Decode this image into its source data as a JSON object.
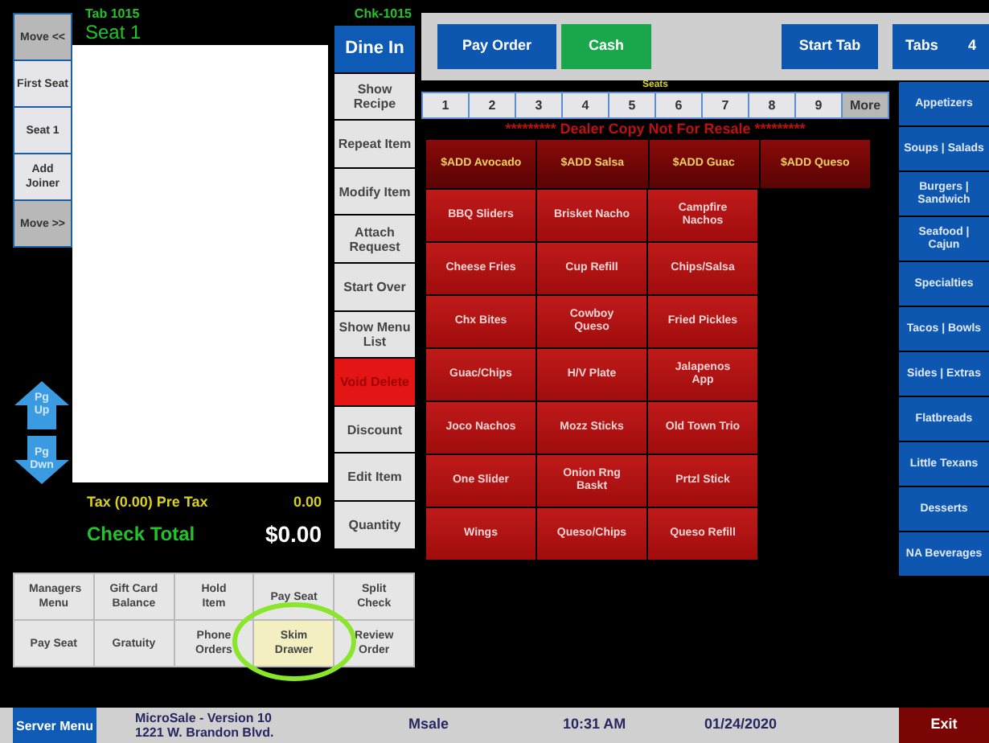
{
  "left_buttons": [
    {
      "label": "Move <<",
      "kind": "nav"
    },
    {
      "label": "First Seat",
      "kind": "seat"
    },
    {
      "label": "Seat 1",
      "kind": "seat"
    },
    {
      "label": "Add Joiner",
      "kind": "seat"
    },
    {
      "label": "Move >>",
      "kind": "nav"
    }
  ],
  "page_buttons": [
    {
      "label": "Pg Up",
      "kind": "up"
    },
    {
      "label": "Pg Dwn",
      "kind": "down"
    }
  ],
  "check": {
    "tab": "Tab  1015",
    "number": "Chk-1015",
    "seat": "Seat 1",
    "tax_label": "Tax (0.00)  Pre Tax",
    "tax_value": "0.00",
    "total_label": "Check Total",
    "total_value": "$0.00"
  },
  "function_buttons": [
    {
      "label": "Dine In",
      "kind": "blue"
    },
    {
      "label": "Show Recipe",
      "kind": "gray"
    },
    {
      "label": "Repeat Item",
      "kind": "gray"
    },
    {
      "label": "Modify Item",
      "kind": "gray"
    },
    {
      "label": "Attach Request",
      "kind": "gray"
    },
    {
      "label": "Start Over",
      "kind": "gray"
    },
    {
      "label": "Show Menu List",
      "kind": "gray"
    },
    {
      "label": "Void Delete",
      "kind": "red"
    },
    {
      "label": "Discount",
      "kind": "gray"
    },
    {
      "label": "Edit Item",
      "kind": "gray"
    },
    {
      "label": "Quantity",
      "kind": "gray"
    }
  ],
  "bottom_buttons": [
    {
      "label": "Managers Menu",
      "highlighted": false
    },
    {
      "label": "Gift Card Balance",
      "highlighted": false
    },
    {
      "label": "Hold Item",
      "highlighted": false
    },
    {
      "label": "Pay Seat",
      "highlighted": false
    },
    {
      "label": "Split Check",
      "highlighted": false
    },
    {
      "label": "Pay Seat",
      "highlighted": false
    },
    {
      "label": "Gratuity",
      "highlighted": false
    },
    {
      "label": "Phone Orders",
      "highlighted": false
    },
    {
      "label": "Skim Drawer",
      "highlighted": true
    },
    {
      "label": "Review Order",
      "highlighted": false
    }
  ],
  "top_buttons": [
    {
      "label": "Pay Order",
      "kind": "blue"
    },
    {
      "label": "Cash",
      "kind": "green"
    },
    {
      "label": "Start Tab",
      "kind": "blue"
    }
  ],
  "tabs_button": {
    "label": "Tabs",
    "count": "4"
  },
  "seats": {
    "title": "Seats",
    "items": [
      {
        "label": "1",
        "kind": "seat"
      },
      {
        "label": "2",
        "kind": "seat"
      },
      {
        "label": "3",
        "kind": "seat"
      },
      {
        "label": "4",
        "kind": "seat"
      },
      {
        "label": "5",
        "kind": "seat"
      },
      {
        "label": "6",
        "kind": "seat"
      },
      {
        "label": "7",
        "kind": "seat"
      },
      {
        "label": "8",
        "kind": "seat"
      },
      {
        "label": "9",
        "kind": "seat"
      },
      {
        "label": "More",
        "kind": "more"
      }
    ]
  },
  "notice": "********* Dealer Copy Not For Resale *********",
  "add_ons": [
    "$ADD Avocado",
    "$ADD Salsa",
    "$ADD Guac",
    "$ADD Queso"
  ],
  "menu_items": [
    "BBQ Sliders",
    "Brisket Nacho",
    "Campfire Nachos",
    "Cheese Fries",
    "Cup Refill",
    "Chips/Salsa",
    "Chx Bites",
    "Cowboy Queso",
    "Fried Pickles",
    "Guac/Chips",
    "H/V Plate",
    "Jalapenos App",
    "Joco Nachos",
    "Mozz Sticks",
    "Old Town Trio",
    "One Slider",
    "Onion Rng Baskt",
    "Prtzl Stick",
    "Wings",
    "Queso/Chips",
    "Queso Refill"
  ],
  "categories": [
    "Appetizers",
    "Soups | Salads",
    "Burgers | Sandwich",
    "Seafood | Cajun",
    "Specialties",
    "Tacos | Bowls",
    "Sides | Extras",
    "Flatbreads",
    "Little Texans",
    "Desserts",
    "NA Beverages"
  ],
  "footer": {
    "server_button": "Server Menu",
    "version": "MicroSale - Version 10",
    "address": "1221 W. Brandon Blvd.",
    "user": "Msale",
    "time": "10:31 AM",
    "date": "01/24/2020",
    "exit_button": "Exit"
  },
  "annotation": {
    "kind": "ellipse"
  }
}
